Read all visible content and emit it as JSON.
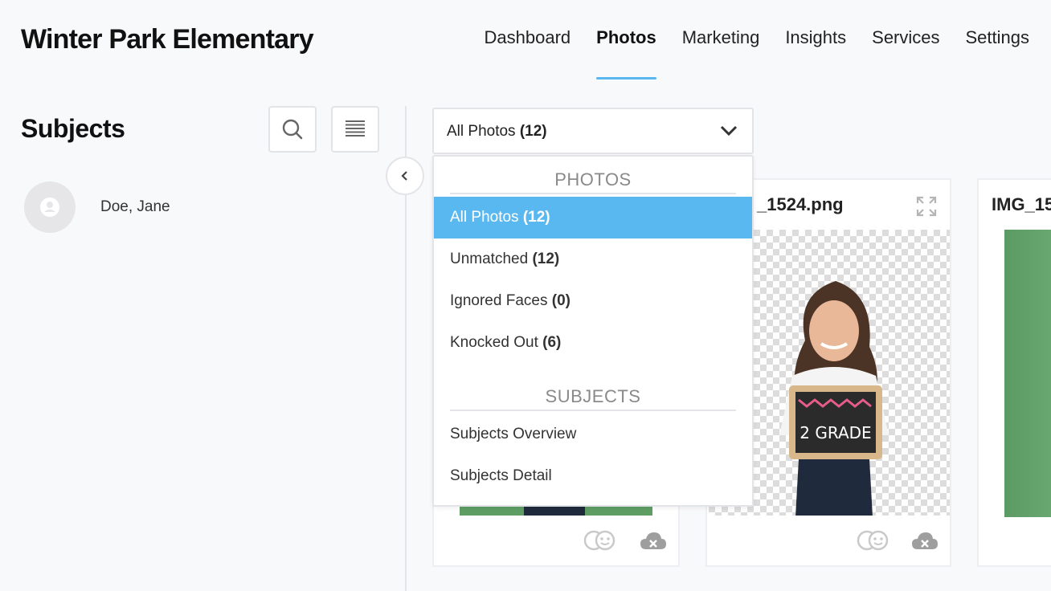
{
  "header": {
    "title": "Winter Park Elementary",
    "nav": [
      {
        "label": "Dashboard",
        "active": false
      },
      {
        "label": "Photos",
        "active": true
      },
      {
        "label": "Marketing",
        "active": false
      },
      {
        "label": "Insights",
        "active": false
      },
      {
        "label": "Services",
        "active": false
      },
      {
        "label": "Settings",
        "active": false
      }
    ]
  },
  "sidebar": {
    "title": "Subjects",
    "search_icon": "search-icon",
    "list_icon": "list-view-icon",
    "subjects": [
      {
        "name": "Doe, Jane",
        "icon": "user-avatar-icon"
      }
    ],
    "collapse_icon": "chevron-left-icon"
  },
  "filter": {
    "selected_label": "All Photos",
    "selected_count": "(12)",
    "chevron_icon": "chevron-down-icon",
    "menu": {
      "photos_header": "PHOTOS",
      "photo_options": [
        {
          "label": "All Photos",
          "count": "(12)",
          "selected": true
        },
        {
          "label": "Unmatched",
          "count": "(12)",
          "selected": false
        },
        {
          "label": "Ignored Faces",
          "count": "(0)",
          "selected": false
        },
        {
          "label": "Knocked Out",
          "count": "(6)",
          "selected": false
        }
      ],
      "subjects_header": "SUBJECTS",
      "subject_options": [
        {
          "label": "Subjects Overview"
        },
        {
          "label": "Subjects Detail"
        }
      ]
    }
  },
  "photos": [
    {
      "title": "",
      "actions": [
        "face-match-icon",
        "cloud-remove-icon"
      ]
    },
    {
      "title": "_1524.png",
      "expand_icon": "expand-icon",
      "actions": [
        "face-match-icon",
        "cloud-remove-icon"
      ]
    },
    {
      "title": "IMG_15",
      "actions": []
    }
  ],
  "colors": {
    "accent": "#5ab8f0",
    "background": "#f8f9fb",
    "border": "#e2e4e8"
  }
}
